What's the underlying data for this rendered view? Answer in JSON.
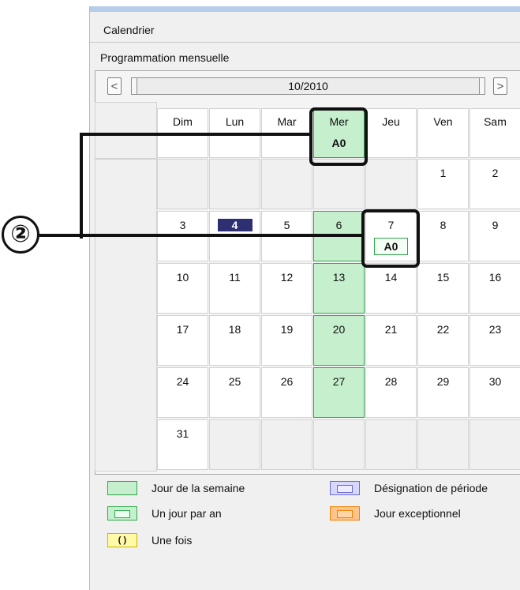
{
  "window": {
    "title": "Calendrier",
    "subtitle": "Programmation mensuelle"
  },
  "nav": {
    "prev_label": "<",
    "next_label": ">",
    "month": "10/2010"
  },
  "days": [
    "Dim",
    "Lun",
    "Mar",
    "Mer",
    "Jeu",
    "Ven",
    "Sam"
  ],
  "header_code": "A0",
  "weeks": [
    [
      "",
      "",
      "",
      "",
      "",
      "1",
      "2"
    ],
    [
      "3",
      "4",
      "5",
      "6",
      "7",
      "8",
      "9"
    ],
    [
      "10",
      "11",
      "12",
      "13",
      "14",
      "15",
      "16"
    ],
    [
      "17",
      "18",
      "19",
      "20",
      "21",
      "22",
      "23"
    ],
    [
      "24",
      "25",
      "26",
      "27",
      "28",
      "29",
      "30"
    ],
    [
      "31",
      "",
      "",
      "",
      "",
      "",
      ""
    ]
  ],
  "today": "4",
  "day_badge": {
    "day": "7",
    "code": "A0"
  },
  "legend": {
    "weekday": "Jour de la semaine",
    "yearly": "Un jour par an",
    "once": "Une fois",
    "once_symbol": "( )",
    "period": "Désignation de période",
    "exceptional": "Jour exceptionnel"
  },
  "callout_number": "②",
  "colors": {
    "weekday_fill": "#c6efce",
    "weekday_border": "#2fa84a",
    "today_fill": "#2e2e73",
    "period": "#6b6bd6",
    "exceptional": "#f08000",
    "once": "#fff9a8"
  }
}
